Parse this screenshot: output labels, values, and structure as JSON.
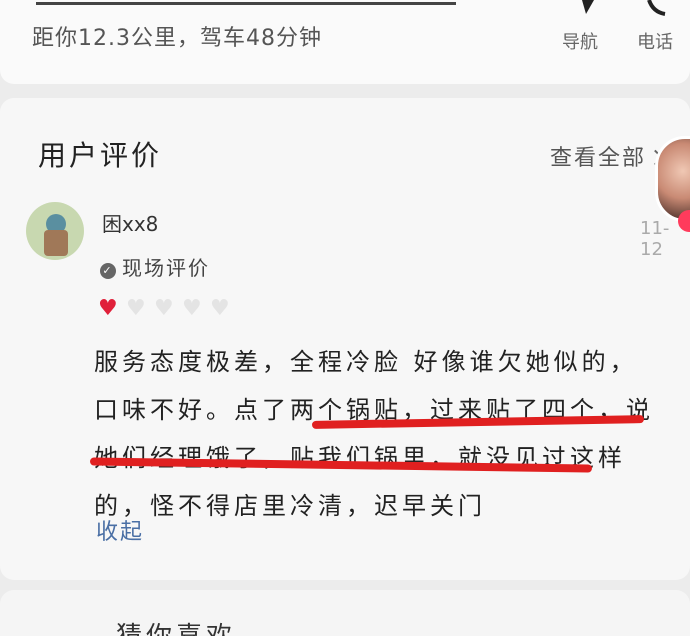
{
  "store": {
    "distance": "距你12.3公里，驾车48分钟",
    "actions": {
      "navigate_label": "导航",
      "phone_label": "电话"
    }
  },
  "reviews": {
    "section_title": "用户评价",
    "view_all": "查看全部",
    "review": {
      "username": "困xx8",
      "tag": "现场评价",
      "date": "11-12",
      "rating": {
        "filled": 1,
        "total": 5
      },
      "text": "服务态度极差，全程冷脸 好像谁欠她似的，口味不好。点了两个锅贴，过来贴了四个，说她们经理饿了，贴我们锅里，就没见过这样的，怪不得店里冷清，迟早关门",
      "collapse": "收起"
    }
  },
  "next_section": {
    "title": "猜你喜欢"
  },
  "colors": {
    "accent_red": "#e02020",
    "link_blue": "#4a6fa5"
  }
}
